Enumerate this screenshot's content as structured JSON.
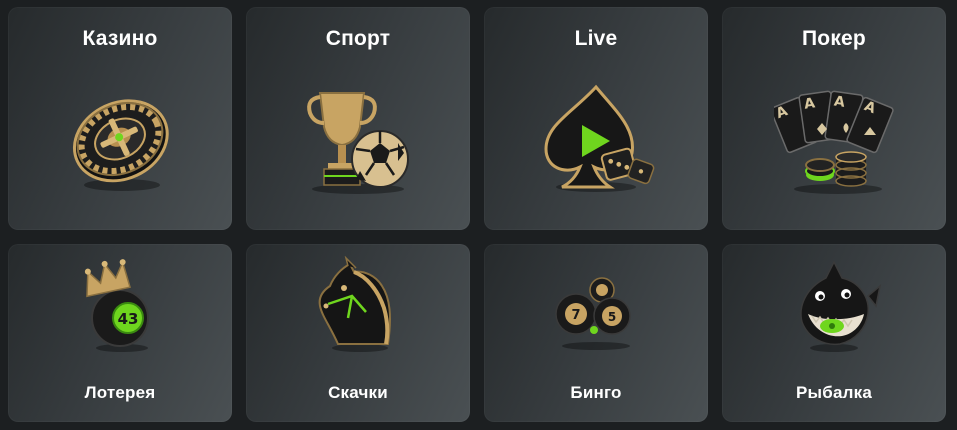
{
  "categories": [
    {
      "label": "Казино",
      "icon": "roulette-wheel-icon"
    },
    {
      "label": "Спорт",
      "icon": "trophy-soccer-ball-icon"
    },
    {
      "label": "Live",
      "icon": "spade-play-dice-icon"
    },
    {
      "label": "Покер",
      "icon": "poker-cards-chips-icon"
    },
    {
      "label": "Лотерея",
      "icon": "lottery-ball-crown-icon"
    },
    {
      "label": "Скачки",
      "icon": "horse-head-icon"
    },
    {
      "label": "Бинго",
      "icon": "bingo-balls-icon"
    },
    {
      "label": "Рыбалка",
      "icon": "shark-fish-icon"
    }
  ],
  "colors": {
    "accent": "#6fd61e",
    "gold": "#c8a463",
    "tile_dark": "#262a2c",
    "tile_light": "#4a5053",
    "page_bg": "#1c1f21"
  }
}
